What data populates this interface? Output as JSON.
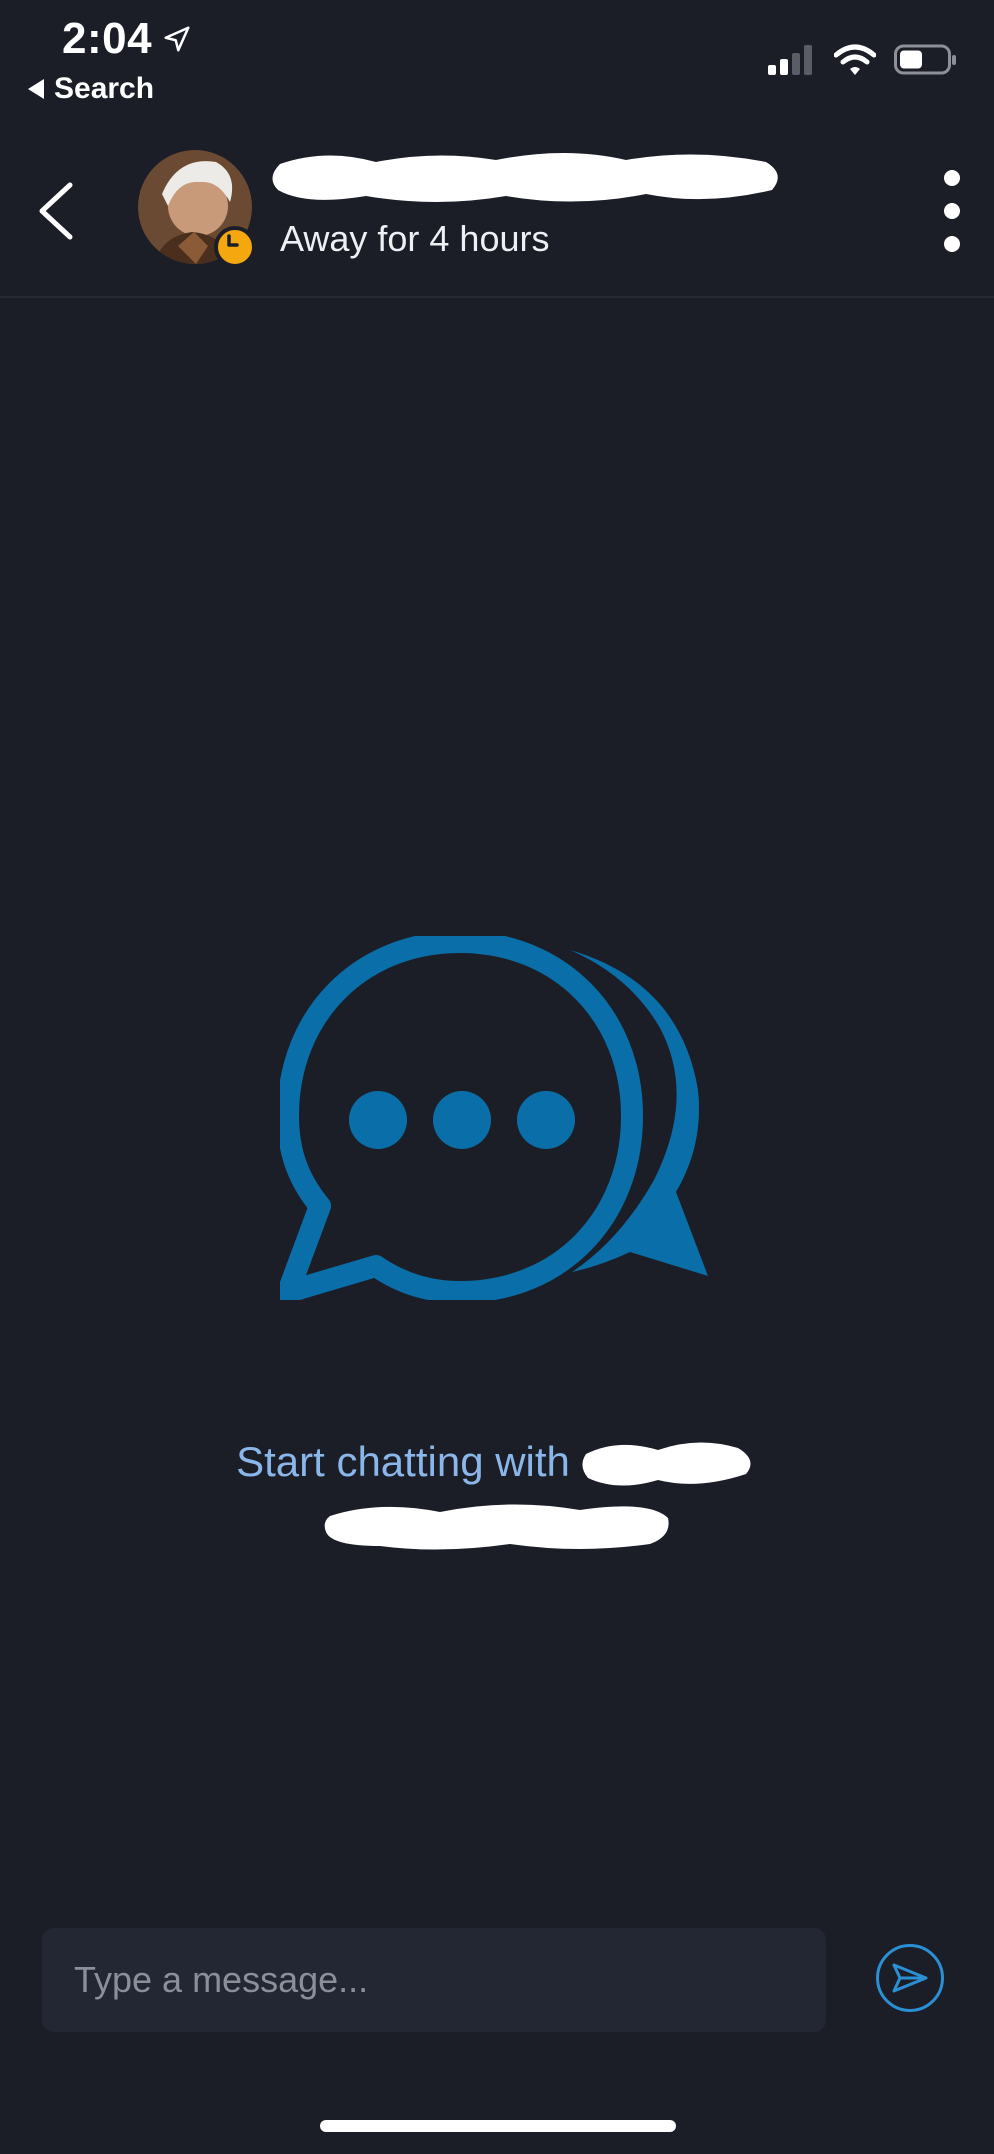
{
  "status_bar": {
    "time": "2:04",
    "back_app_label": "Search",
    "icons": [
      "location-arrow-icon",
      "cellular-signal-icon",
      "wifi-icon",
      "battery-icon"
    ]
  },
  "header": {
    "presence_status": "Away for 4 hours",
    "presence_color": "#f5a70f",
    "icons": [
      "chevron-left-icon",
      "more-vertical-icon",
      "clock-icon"
    ]
  },
  "empty_state": {
    "prompt": "Start chatting with",
    "illustration_color": "#0a6ea8",
    "prompt_color": "#8ab6ea"
  },
  "composer": {
    "placeholder": "Type a message...",
    "value": "",
    "send_icon": "send-icon",
    "accent_color": "#2b8fd4"
  },
  "theme": {
    "background": "#1b1e27",
    "input_background": "#232733"
  }
}
